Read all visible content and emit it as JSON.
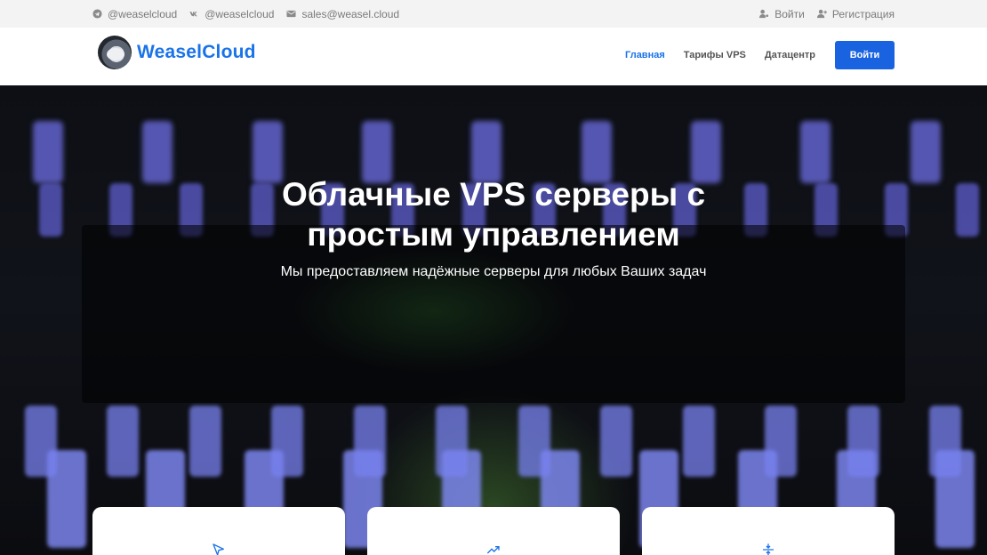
{
  "topbar": {
    "telegram": {
      "icon": "telegram-icon",
      "text": "@weaselcloud"
    },
    "vk": {
      "icon": "vk-icon",
      "text": "@weaselcloud"
    },
    "email": {
      "icon": "envelope-icon",
      "text": "sales@weasel.cloud"
    },
    "login": {
      "icon": "user-key-icon",
      "text": "Войти"
    },
    "register": {
      "icon": "user-plus-icon",
      "text": "Регистрация"
    }
  },
  "header": {
    "logo_text": "WeaselCloud",
    "nav": [
      {
        "label": "Главная",
        "active": true
      },
      {
        "label": "Тарифы VPS",
        "active": false
      },
      {
        "label": "Датацентр",
        "active": false
      }
    ],
    "login_button": "Войти"
  },
  "hero": {
    "title_line1": "Облачные VPS серверы с",
    "title_line2": "простым управлением",
    "subtitle": "Мы предоставляем надёжные серверы для любых Ваших задач"
  },
  "features": [
    {
      "icon": "cursor-icon"
    },
    {
      "icon": "trending-up-icon"
    },
    {
      "icon": "arrows-compress-icon"
    }
  ],
  "colors": {
    "accent": "#1a73e8",
    "button": "#1a63e0",
    "topbar_bg": "#f3f3f3"
  }
}
